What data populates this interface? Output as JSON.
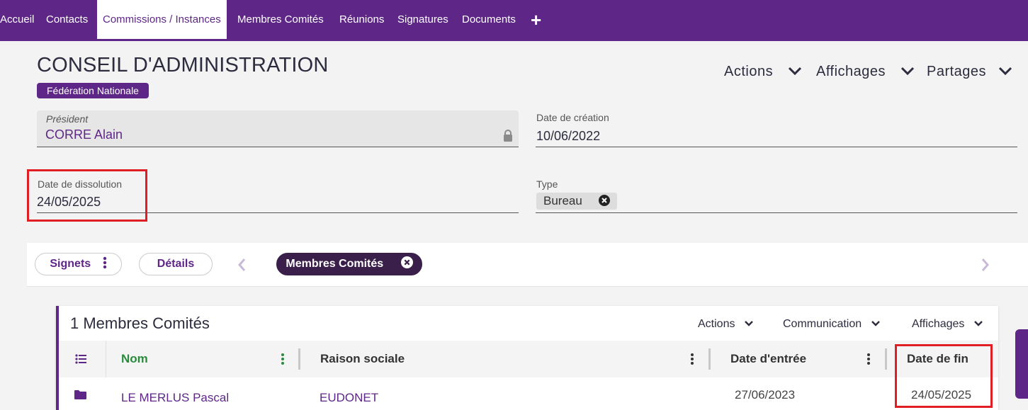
{
  "nav": {
    "items": [
      "Accueil",
      "Contacts",
      "Commissions / Instances",
      "Membres Comités",
      "Réunions",
      "Signatures",
      "Documents"
    ],
    "plus": "+"
  },
  "record": {
    "title": "CONSEIL D'ADMINISTRATION",
    "badge": "Fédération Nationale"
  },
  "top_actions": {
    "actions": "Actions",
    "affichages": "Affichages",
    "partages": "Partages"
  },
  "fields": {
    "president_label": "Président",
    "president_value": "CORRE Alain",
    "creation_label": "Date de création",
    "creation_value": "10/06/2022",
    "dissolution_label": "Date de dissolution",
    "dissolution_value": "24/05/2025",
    "type_label": "Type",
    "type_value": "Bureau"
  },
  "bookmarks": {
    "signets": "Signets",
    "details": "Détails",
    "active_tab": "Membres Comités"
  },
  "list": {
    "title": "1 Membres Comités",
    "actions": "Actions",
    "communication": "Communication",
    "affichages": "Affichages",
    "columns": [
      "Nom",
      "Raison sociale",
      "Date d'entrée",
      "Date de fin"
    ],
    "rows": [
      {
        "nom": "LE MERLUS Pascal",
        "raison": "EUDONET",
        "entree": "27/06/2023",
        "fin": "24/05/2025"
      }
    ]
  },
  "colors": {
    "brand": "#5e2787",
    "highlight": "#e01e24",
    "accent_green": "#2a8a3e"
  }
}
